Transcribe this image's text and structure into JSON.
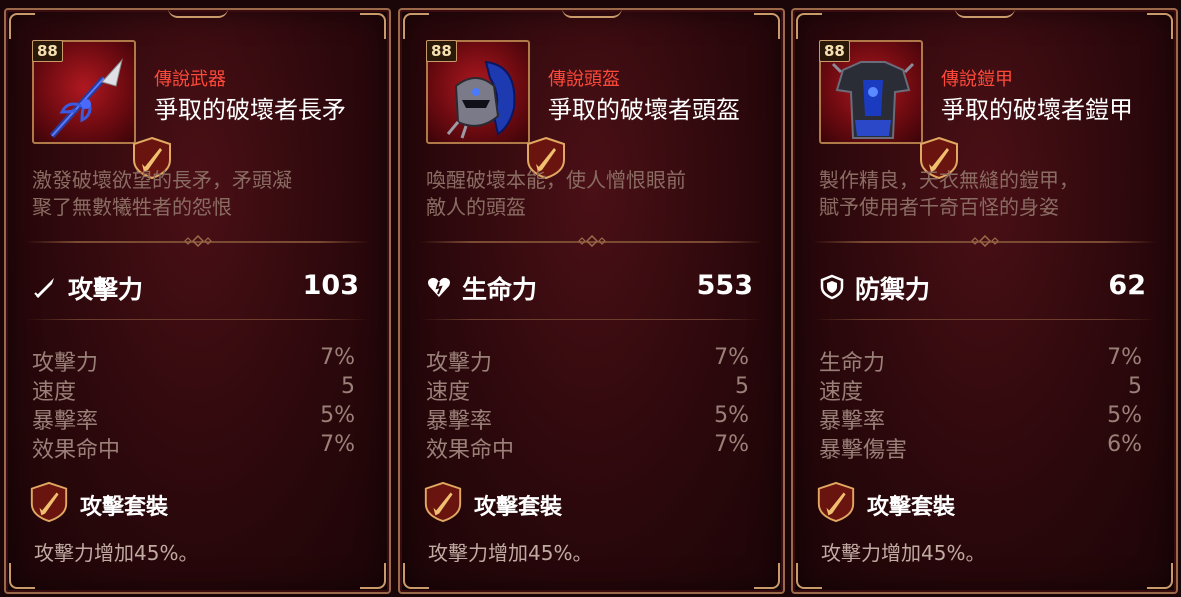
{
  "colors": {
    "rarity": "#ff4a3a",
    "card_bg": "#3a0a0e",
    "border": "#9a6a4a",
    "desc": "#8a6c62",
    "substat": "#9a8078"
  },
  "cards": [
    {
      "level": "88",
      "item_icon": "spear-icon",
      "rarity": "傳說武器",
      "name": "爭取的破壞者長矛",
      "description_lines": [
        "激發破壞欲望的長矛，矛頭凝",
        "聚了無數犧牲者的怨恨"
      ],
      "main_stat": {
        "icon": "sword-icon",
        "label": "攻擊力",
        "value": "103"
      },
      "substats": [
        {
          "label": "攻擊力",
          "value": "7%"
        },
        {
          "label": "速度",
          "value": "5"
        },
        {
          "label": "暴擊率",
          "value": "5%"
        },
        {
          "label": "效果命中",
          "value": "7%"
        }
      ],
      "set": {
        "icon": "attack-set-icon",
        "name": "攻擊套裝",
        "effect": "攻擊力增加45%。"
      }
    },
    {
      "level": "88",
      "item_icon": "helmet-icon",
      "rarity": "傳說頭盔",
      "name": "爭取的破壞者頭盔",
      "description_lines": [
        "喚醒破壞本能，使人憎恨眼前",
        "敵人的頭盔"
      ],
      "main_stat": {
        "icon": "heart-icon",
        "label": "生命力",
        "value": "553"
      },
      "substats": [
        {
          "label": "攻擊力",
          "value": "7%"
        },
        {
          "label": "速度",
          "value": "5"
        },
        {
          "label": "暴擊率",
          "value": "5%"
        },
        {
          "label": "效果命中",
          "value": "7%"
        }
      ],
      "set": {
        "icon": "attack-set-icon",
        "name": "攻擊套裝",
        "effect": "攻擊力增加45%。"
      }
    },
    {
      "level": "88",
      "item_icon": "armor-icon",
      "rarity": "傳說鎧甲",
      "name": "爭取的破壞者鎧甲",
      "description_lines": [
        "製作精良，天衣無縫的鎧甲，",
        "賦予使用者千奇百怪的身姿"
      ],
      "main_stat": {
        "icon": "shield-icon",
        "label": "防禦力",
        "value": "62"
      },
      "substats": [
        {
          "label": "生命力",
          "value": "7%"
        },
        {
          "label": "速度",
          "value": "5"
        },
        {
          "label": "暴擊率",
          "value": "5%"
        },
        {
          "label": "暴擊傷害",
          "value": "6%"
        }
      ],
      "set": {
        "icon": "attack-set-icon",
        "name": "攻擊套裝",
        "effect": "攻擊力增加45%。"
      }
    }
  ]
}
